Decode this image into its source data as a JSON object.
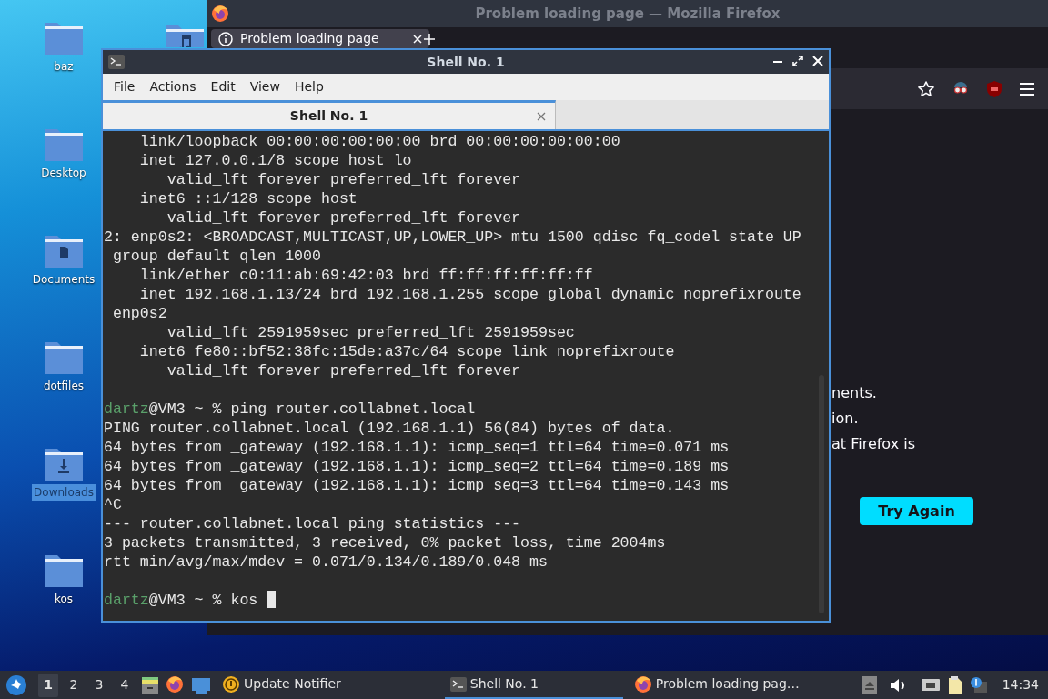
{
  "desktop_icons": [
    {
      "label": "baz",
      "kind": "folder",
      "selected": false
    },
    {
      "label": "Desktop",
      "kind": "folder",
      "selected": false
    },
    {
      "label": "Documents",
      "kind": "documents",
      "selected": false
    },
    {
      "label": "dotfiles",
      "kind": "folder",
      "selected": false
    },
    {
      "label": "Downloads",
      "kind": "downloads",
      "selected": true
    },
    {
      "label": "kos",
      "kind": "folder",
      "selected": false
    }
  ],
  "browser": {
    "title": "Problem loading page — Mozilla Firefox",
    "tab": "Problem loading page",
    "page_text": [
      "nents.",
      "ion.",
      "at Firefox is"
    ],
    "button": "Try Again"
  },
  "terminal": {
    "title": "Shell No. 1",
    "menu": [
      "File",
      "Actions",
      "Edit",
      "View",
      "Help"
    ],
    "tabs": [
      {
        "label": "Shell No. 1",
        "selected": true
      }
    ],
    "lines": [
      {
        "kind": "output",
        "text": "    link/loopback 00:00:00:00:00:00 brd 00:00:00:00:00:00"
      },
      {
        "kind": "output",
        "text": "    inet 127.0.0.1/8 scope host lo"
      },
      {
        "kind": "output",
        "text": "       valid_lft forever preferred_lft forever"
      },
      {
        "kind": "output",
        "text": "    inet6 ::1/128 scope host"
      },
      {
        "kind": "output",
        "text": "       valid_lft forever preferred_lft forever"
      },
      {
        "kind": "output",
        "text": "2: enp0s2: <BROADCAST,MULTICAST,UP,LOWER_UP> mtu 1500 qdisc fq_codel state UP"
      },
      {
        "kind": "output",
        "text": " group default qlen 1000"
      },
      {
        "kind": "output",
        "text": "    link/ether c0:11:ab:69:42:03 brd ff:ff:ff:ff:ff:ff"
      },
      {
        "kind": "output",
        "text": "    inet 192.168.1.13/24 brd 192.168.1.255 scope global dynamic noprefixroute"
      },
      {
        "kind": "output",
        "text": " enp0s2"
      },
      {
        "kind": "output",
        "text": "       valid_lft 2591959sec preferred_lft 2591959sec"
      },
      {
        "kind": "output",
        "text": "    inet6 fe80::bf52:38fc:15de:a37c/64 scope link noprefixroute"
      },
      {
        "kind": "output",
        "text": "       valid_lft forever preferred_lft forever"
      },
      {
        "kind": "blank"
      },
      {
        "kind": "prompt",
        "user": "dartz",
        "host": "@VM3 ~ % ",
        "command": "ping router.collabnet.local",
        "cursor": false
      },
      {
        "kind": "output",
        "text": "PING router.collabnet.local (192.168.1.1) 56(84) bytes of data."
      },
      {
        "kind": "output",
        "text": "64 bytes from _gateway (192.168.1.1): icmp_seq=1 ttl=64 time=0.071 ms"
      },
      {
        "kind": "output",
        "text": "64 bytes from _gateway (192.168.1.1): icmp_seq=2 ttl=64 time=0.189 ms"
      },
      {
        "kind": "output",
        "text": "64 bytes from _gateway (192.168.1.1): icmp_seq=3 ttl=64 time=0.143 ms"
      },
      {
        "kind": "output",
        "text": "^C"
      },
      {
        "kind": "output",
        "text": "--- router.collabnet.local ping statistics ---"
      },
      {
        "kind": "output",
        "text": "3 packets transmitted, 3 received, 0% packet loss, time 2004ms"
      },
      {
        "kind": "output",
        "text": "rtt min/avg/max/mdev = 0.071/0.134/0.189/0.048 ms"
      },
      {
        "kind": "blank"
      },
      {
        "kind": "prompt",
        "user": "dartz",
        "host": "@VM3 ~ % ",
        "command": "kos",
        "cursor": true
      }
    ]
  },
  "taskbar": {
    "workspaces": [
      {
        "label": "1",
        "selected": true
      },
      {
        "label": "2",
        "selected": false
      },
      {
        "label": "3",
        "selected": false
      },
      {
        "label": "4",
        "selected": false
      }
    ],
    "launcher": "Update Notifier",
    "tasks": [
      {
        "kind": "terminal",
        "label": "Shell No. 1",
        "selected": true
      },
      {
        "kind": "browser",
        "label": "Problem loading pag…",
        "selected": false
      }
    ],
    "clock": "14:34"
  }
}
